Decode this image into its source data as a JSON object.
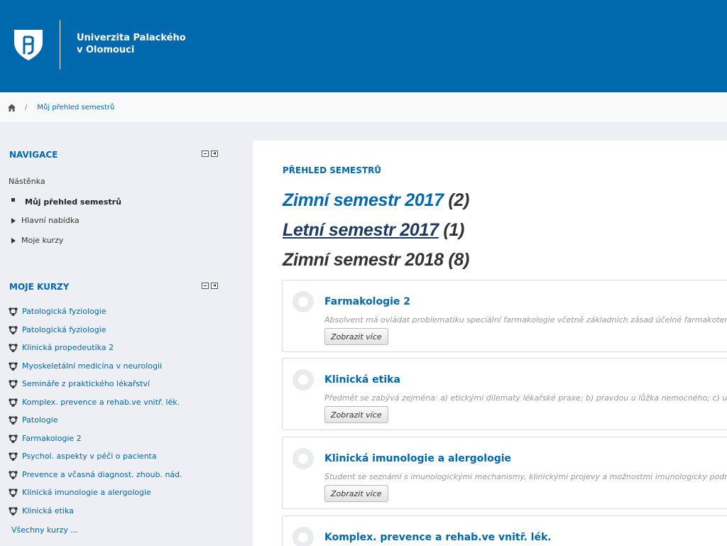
{
  "header": {
    "university_line1": "Univerzita Palackého",
    "university_line2": "v Olomouci",
    "brand_color": "#0068ad"
  },
  "breadcrumb": {
    "home_icon": "home-icon",
    "separator": "/",
    "current": "Můj přehled semestrů"
  },
  "sidebar": {
    "navigation": {
      "title": "NAVIGACE",
      "dashboard": "Nástěnka",
      "my_overview": "Můj přehled semestrů",
      "main_menu": "Hlavní nabídka",
      "my_courses_link": "Moje kurzy"
    },
    "my_courses": {
      "title": "MOJE KURZY",
      "items": [
        "Patologická fyziologie",
        "Patologická fyziologie",
        "Klinická propedeutika 2",
        "Myoskeletální medicína v neurologii",
        "Semináře z praktického lékařství",
        "Komplex. prevence a rehab.ve vnitř. lék.",
        "Patologie",
        "Farmakologie 2",
        "Psychol. aspekty v péči o pacienta",
        "Prevence a včasná diagnost. zhoub. nád.",
        "Klinická imunologie a alergologie",
        "Klinická etika"
      ],
      "all_courses": "Všechny kurzy ..."
    }
  },
  "main": {
    "section_title": "PŘEHLED SEMESTRŮ",
    "semesters": [
      {
        "name": "Zimní semestr 2017",
        "count": "(2)"
      },
      {
        "name": "Letní semestr 2017",
        "count": "(1)"
      },
      {
        "name": "Zimní semestr 2018",
        "count": "(8)"
      }
    ],
    "courses": [
      {
        "title": "Farmakologie 2",
        "description": "Absolvent má ovládat problematiku speciální farmakologie včetně základních zásad účelné farmakoterapie",
        "button": "Zobrazit více"
      },
      {
        "title": "Klinická etika",
        "description": "Předmět se zabývá zejména: a) etickými dilematy lékařské praxe; b) pravdou u lůžka nemocného; c) ukončování",
        "button": "Zobrazit více"
      },
      {
        "title": "Klinická imunologie a alergologie",
        "description": "Student se seznámí s imunologickými mechanismy, klinickými projevy a možnostmi imunologicky podmíněných",
        "button": "Zobrazit více"
      },
      {
        "title": "Komplex. prevence a rehab.ve vnitř. lék."
      }
    ]
  }
}
